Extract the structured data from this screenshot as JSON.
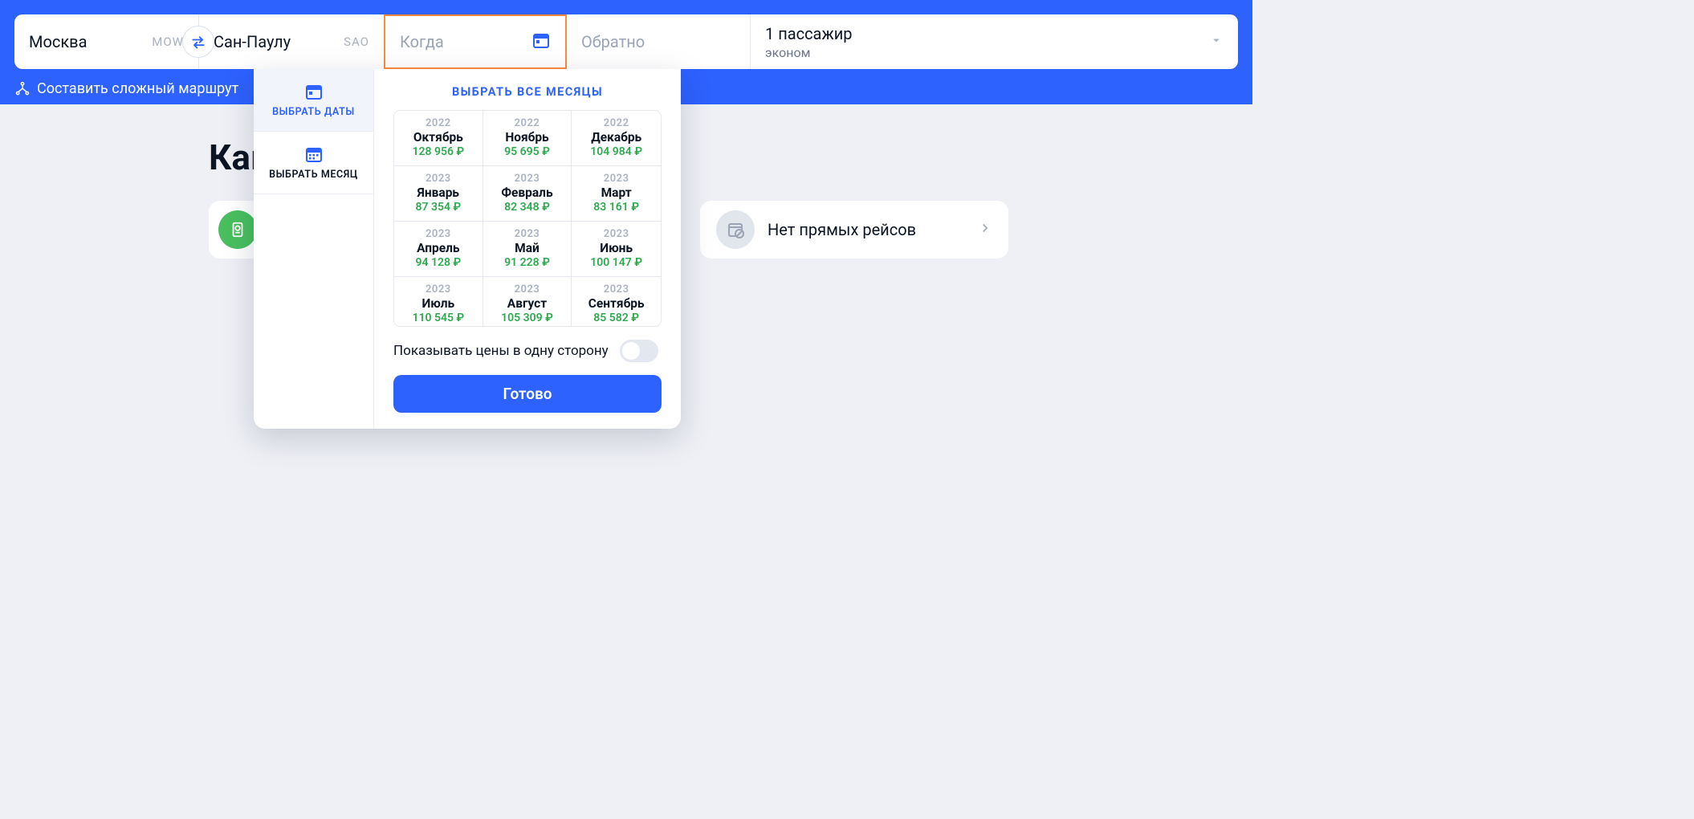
{
  "search": {
    "origin": {
      "city": "Москва",
      "code": "MOW"
    },
    "destination": {
      "city": "Сан-Паулу",
      "code": "SAO"
    },
    "depart_placeholder": "Когда",
    "return_placeholder": "Обратно",
    "passengers": {
      "count_label": "1 пассажир",
      "class_label": "эконом"
    }
  },
  "complex_route_label": "Составить сложный маршрут",
  "headline": "Как",
  "no_direct_label": "Нет прямых рейсов",
  "popover": {
    "tab_dates": "ВЫБРАТЬ ДАТЫ",
    "tab_month": "ВЫБРАТЬ МЕСЯЦ",
    "select_all": "ВЫБРАТЬ ВСЕ МЕСЯЦЫ",
    "months": [
      {
        "year": "2022",
        "month": "Октябрь",
        "price": "128 956 ₽"
      },
      {
        "year": "2022",
        "month": "Ноябрь",
        "price": "95 695 ₽"
      },
      {
        "year": "2022",
        "month": "Декабрь",
        "price": "104 984 ₽"
      },
      {
        "year": "2023",
        "month": "Январь",
        "price": "87 354 ₽"
      },
      {
        "year": "2023",
        "month": "Февраль",
        "price": "82 348 ₽"
      },
      {
        "year": "2023",
        "month": "Март",
        "price": "83 161 ₽"
      },
      {
        "year": "2023",
        "month": "Апрель",
        "price": "94 128 ₽"
      },
      {
        "year": "2023",
        "month": "Май",
        "price": "91 228 ₽"
      },
      {
        "year": "2023",
        "month": "Июнь",
        "price": "100 147 ₽"
      },
      {
        "year": "2023",
        "month": "Июль",
        "price": "110 545 ₽"
      },
      {
        "year": "2023",
        "month": "Август",
        "price": "105 309 ₽"
      },
      {
        "year": "2023",
        "month": "Сентябрь",
        "price": "85 582 ₽"
      }
    ],
    "oneway_label": "Показывать цены в одну сторону",
    "done_label": "Готово"
  }
}
